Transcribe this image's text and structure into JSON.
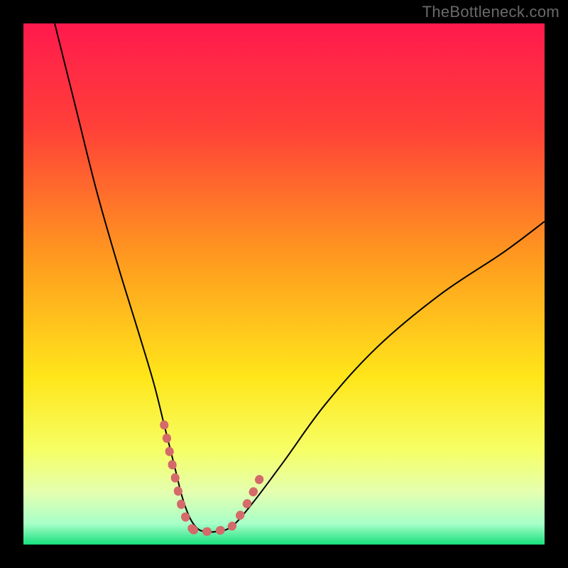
{
  "watermark": "TheBottleneck.com",
  "chart_data": {
    "type": "line",
    "title": "",
    "xlabel": "",
    "ylabel": "",
    "xlim": [
      0,
      100
    ],
    "ylim": [
      0,
      100
    ],
    "gradient_stops": [
      {
        "offset": 0,
        "color": "#ff1a4d"
      },
      {
        "offset": 0.2,
        "color": "#ff4038"
      },
      {
        "offset": 0.45,
        "color": "#ff9a1f"
      },
      {
        "offset": 0.68,
        "color": "#ffe61a"
      },
      {
        "offset": 0.82,
        "color": "#f6ff66"
      },
      {
        "offset": 0.9,
        "color": "#e4ffb0"
      },
      {
        "offset": 0.96,
        "color": "#a8ffc8"
      },
      {
        "offset": 1.0,
        "color": "#18e07e"
      }
    ],
    "series": [
      {
        "name": "bottleneck-curve",
        "stroke": "#000000",
        "stroke_width": 2,
        "x": [
          6,
          10,
          14,
          18,
          22,
          25,
          27,
          29,
          30.5,
          32,
          33.5,
          35,
          37,
          40,
          44,
          50,
          58,
          68,
          80,
          92,
          100
        ],
        "y": [
          100,
          84,
          68,
          54,
          41,
          31,
          23,
          15,
          9,
          5,
          3,
          2.5,
          2.5,
          3.5,
          8,
          16,
          27,
          38,
          48,
          56,
          62
        ]
      },
      {
        "name": "highlight-left",
        "stroke": "#d46a6a",
        "stroke_width": 12,
        "linecap": "round",
        "x": [
          27.0,
          28.2,
          29.3,
          30.2,
          31.0,
          31.8,
          32.6
        ],
        "y": [
          23.0,
          17.0,
          12.0,
          8.0,
          5.5,
          3.8,
          2.8
        ]
      },
      {
        "name": "highlight-bottom",
        "stroke": "#d46a6a",
        "stroke_width": 12,
        "linecap": "round",
        "x": [
          32.6,
          34.0,
          35.5,
          37.0,
          38.5,
          40.0
        ],
        "y": [
          2.8,
          2.5,
          2.5,
          2.5,
          3.0,
          3.5
        ]
      },
      {
        "name": "highlight-right",
        "stroke": "#d46a6a",
        "stroke_width": 12,
        "linecap": "round",
        "x": [
          40.0,
          41.5,
          43.0,
          44.3,
          45.5
        ],
        "y": [
          3.5,
          5.5,
          8.0,
          10.5,
          13.0
        ]
      }
    ]
  }
}
